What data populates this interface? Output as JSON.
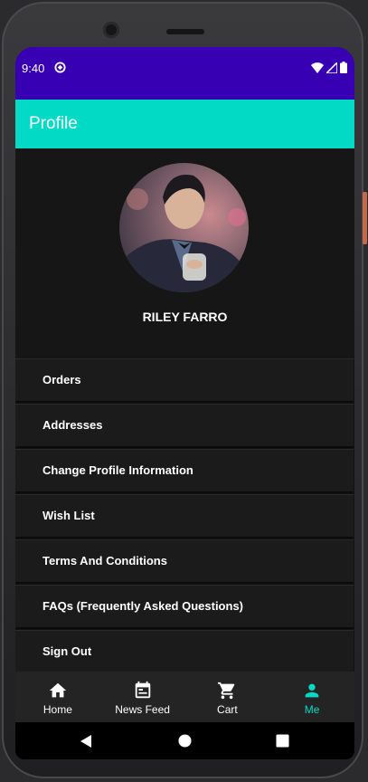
{
  "status_bar": {
    "time": "9:40"
  },
  "app_bar": {
    "title": "Profile"
  },
  "profile": {
    "name": "RILEY FARRO"
  },
  "menu": {
    "items": [
      {
        "label": "Orders"
      },
      {
        "label": "Addresses"
      },
      {
        "label": "Change Profile Information"
      },
      {
        "label": "Wish List"
      },
      {
        "label": "Terms And Conditions"
      },
      {
        "label": "FAQs (Frequently Asked Questions)"
      },
      {
        "label": "Sign Out"
      }
    ]
  },
  "bottom_nav": {
    "items": [
      {
        "label": "Home",
        "icon": "home-icon"
      },
      {
        "label": "News Feed",
        "icon": "calendar-icon"
      },
      {
        "label": "Cart",
        "icon": "cart-icon"
      },
      {
        "label": "Me",
        "icon": "person-icon",
        "active": true
      }
    ]
  },
  "colors": {
    "status_bar": "#3700b3",
    "app_bar": "#03dac5",
    "accent": "#03dac5",
    "background": "#161616"
  }
}
